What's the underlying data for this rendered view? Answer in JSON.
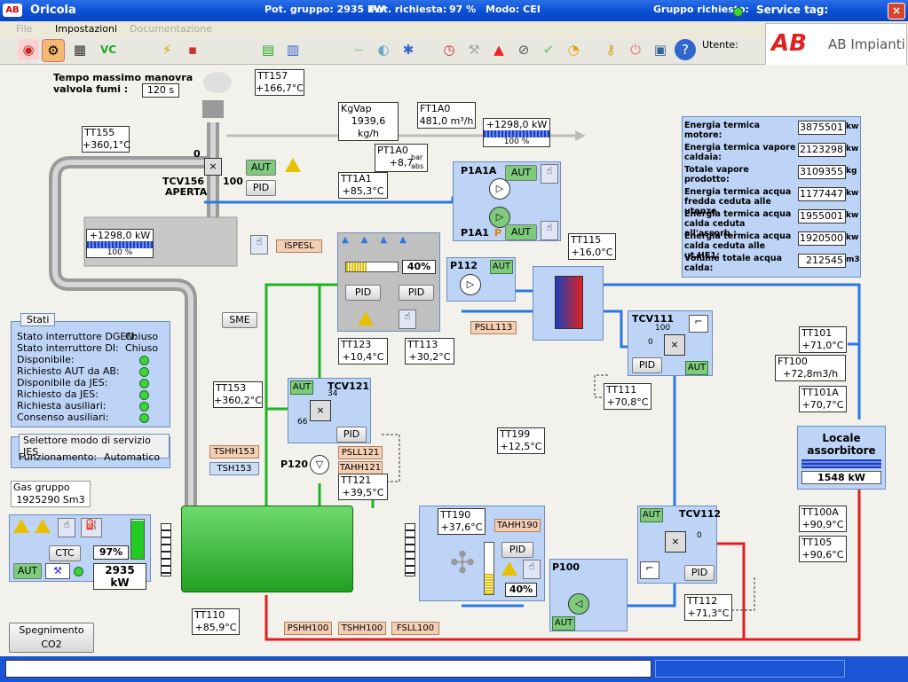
{
  "titlebar": {
    "app": "Oricola",
    "pot_gruppo": "Pot. gruppo: 2935 kW",
    "pot_richiesta": "Pot. richiesta:",
    "pot_richiesta_val": "97 %",
    "modo": "Modo: CEI",
    "gruppo_richiesto": "Gruppo richiesto:",
    "service_tag": "Service tag:"
  },
  "menu": {
    "file": "File",
    "impostazioni": "Impostazioni",
    "documentazione": "Documentazione"
  },
  "toolbar": {
    "utente": "Utente:",
    "logo_text": "AB Impianti",
    "logo_mark": "AB"
  },
  "top": {
    "tempo_label1": "Tempo massimo manovra",
    "tempo_label2": "valvola fumi :",
    "tempo_val": "120 s"
  },
  "tt157": {
    "n": "TT157",
    "v": "+166,7°C"
  },
  "tt155": {
    "n": "TT155",
    "v": "+360,1°C"
  },
  "kgvap": {
    "n": "KgVap",
    "v": "1939,6 kg/h"
  },
  "ft1a0": {
    "n": "FT1A0",
    "v": "481,0 m³/h"
  },
  "steam_kw": {
    "v": "+1298,0 kW",
    "p": "100 %"
  },
  "pt1a0": {
    "n": "PT1A0",
    "v": "+8,7",
    "u1": "bar",
    "u2": "abs"
  },
  "tcv156": {
    "n": "TCV156",
    "s": "APERTA",
    "z": "0",
    "h": "100",
    "aut": "AUT",
    "pid": "PID"
  },
  "tt1a1": {
    "n": "TT1A1",
    "v": "+85,3°C"
  },
  "p1a1a": {
    "n": "P1A1A",
    "aut": "AUT"
  },
  "p1a1": {
    "n": "P1A1",
    "p": "P",
    "aut": "AUT"
  },
  "boiler": {
    "v": "+1298,0 kW",
    "p": "100 %"
  },
  "ispesl": "ISPESL",
  "radiator": {
    "pct": "40%",
    "pid1": "PID",
    "pid2": "PID"
  },
  "p112": {
    "n": "P112",
    "aut": "AUT"
  },
  "tt115": {
    "n": "TT115",
    "v": "+16,0°C"
  },
  "sme": "SME",
  "tt123": {
    "n": "TT123",
    "v": "+10,4°C"
  },
  "tt113": {
    "n": "TT113",
    "v": "+30,2°C"
  },
  "psll113": "PSLL113",
  "tcv111": {
    "n": "TCV111",
    "h": "100",
    "z": "0",
    "pid": "PID",
    "aut": "AUT"
  },
  "tt101": {
    "n": "TT101",
    "v": "+71,0°C"
  },
  "ft100": {
    "n": "FT100",
    "v": "+72,8m3/h"
  },
  "tt101a": {
    "n": "TT101A",
    "v": "+70,7°C"
  },
  "energy": [
    {
      "l": "Energia termica motore:",
      "v": "3875501",
      "u": "kw"
    },
    {
      "l": "Energia termica vapore caldaia:",
      "v": "2123298",
      "u": "kw"
    },
    {
      "l": "Totale vapore prodotto:",
      "v": "3109355",
      "u": "kg"
    },
    {
      "l": "Energia termica acqua fredda ceduta alle utenze",
      "v": "1177447",
      "u": "kw"
    },
    {
      "l": "Energia termica acqua calda ceduta all'assorb.:",
      "v": "1955001",
      "u": "kw"
    },
    {
      "l": "Energia termica acqua calda ceduta alle ut.HE1:",
      "v": "1920500",
      "u": "kw"
    },
    {
      "l": "Volume totale acqua calda:",
      "v": "212545",
      "u": "m3"
    }
  ],
  "stati": {
    "title": "Stati",
    "rows": [
      {
        "l": "Stato interruttore DGEN:",
        "v": "Chiuso"
      },
      {
        "l": "Stato interruttore DI:",
        "v": "Chiuso"
      },
      {
        "l": "Disponibile:",
        "v": ""
      },
      {
        "l": "Richiesto AUT da AB:",
        "v": ""
      },
      {
        "l": "Disponibile da JES:",
        "v": ""
      },
      {
        "l": "Richiesto da JES:",
        "v": ""
      },
      {
        "l": "Richiesta ausiliari:",
        "v": ""
      },
      {
        "l": "Consenso ausiliari:",
        "v": ""
      }
    ]
  },
  "selettore": {
    "title": "Selettore modo di servizio JES",
    "l": "Funzionamento:",
    "v": "Automatico"
  },
  "tt153": {
    "n": "TT153",
    "v": "+360,2°C"
  },
  "tcv121": {
    "n": "TCV121",
    "aut": "AUT",
    "h": "34",
    "z": "66",
    "pid": "PID"
  },
  "tt111": {
    "n": "TT111",
    "v": "+70,8°C"
  },
  "tt199": {
    "n": "TT199",
    "v": "+12,5°C"
  },
  "tsh153": "TSHH153",
  "tsh153b": "TSH153",
  "psll121": "PSLL121",
  "tahh121": "TAHH121",
  "p120": "P120",
  "tt121": {
    "n": "TT121",
    "v": "+39,5°C"
  },
  "gas": {
    "l": "Gas gruppo",
    "v": "1925290 Sm3"
  },
  "engine": {
    "ctc": "CTC",
    "pct": "97%",
    "kw": "2935 kW",
    "aut": "AUT"
  },
  "locale": {
    "t1": "Locale",
    "t2": "assorbitore",
    "kw": "1548 kW"
  },
  "tt190": {
    "n": "TT190",
    "v": "+37,6°C",
    "tahh": "TAHH190",
    "pid": "PID",
    "pct": "40%"
  },
  "tcv112": {
    "n": "TCV112",
    "aut": "AUT",
    "z": "0",
    "pid": "PID"
  },
  "tt100a": {
    "n": "TT100A",
    "v": "+90,9°C"
  },
  "tt105": {
    "n": "TT105",
    "v": "+90,6°C"
  },
  "p100": {
    "n": "P100",
    "aut": "AUT"
  },
  "tt112": {
    "n": "TT112",
    "v": "+71,3°C"
  },
  "tt110": {
    "n": "TT110",
    "v": "+85,9°C"
  },
  "spegn": "Spegnimento CO2",
  "alarms_bottom": [
    "PSHH100",
    "TSHH100",
    "FSLL100"
  ]
}
